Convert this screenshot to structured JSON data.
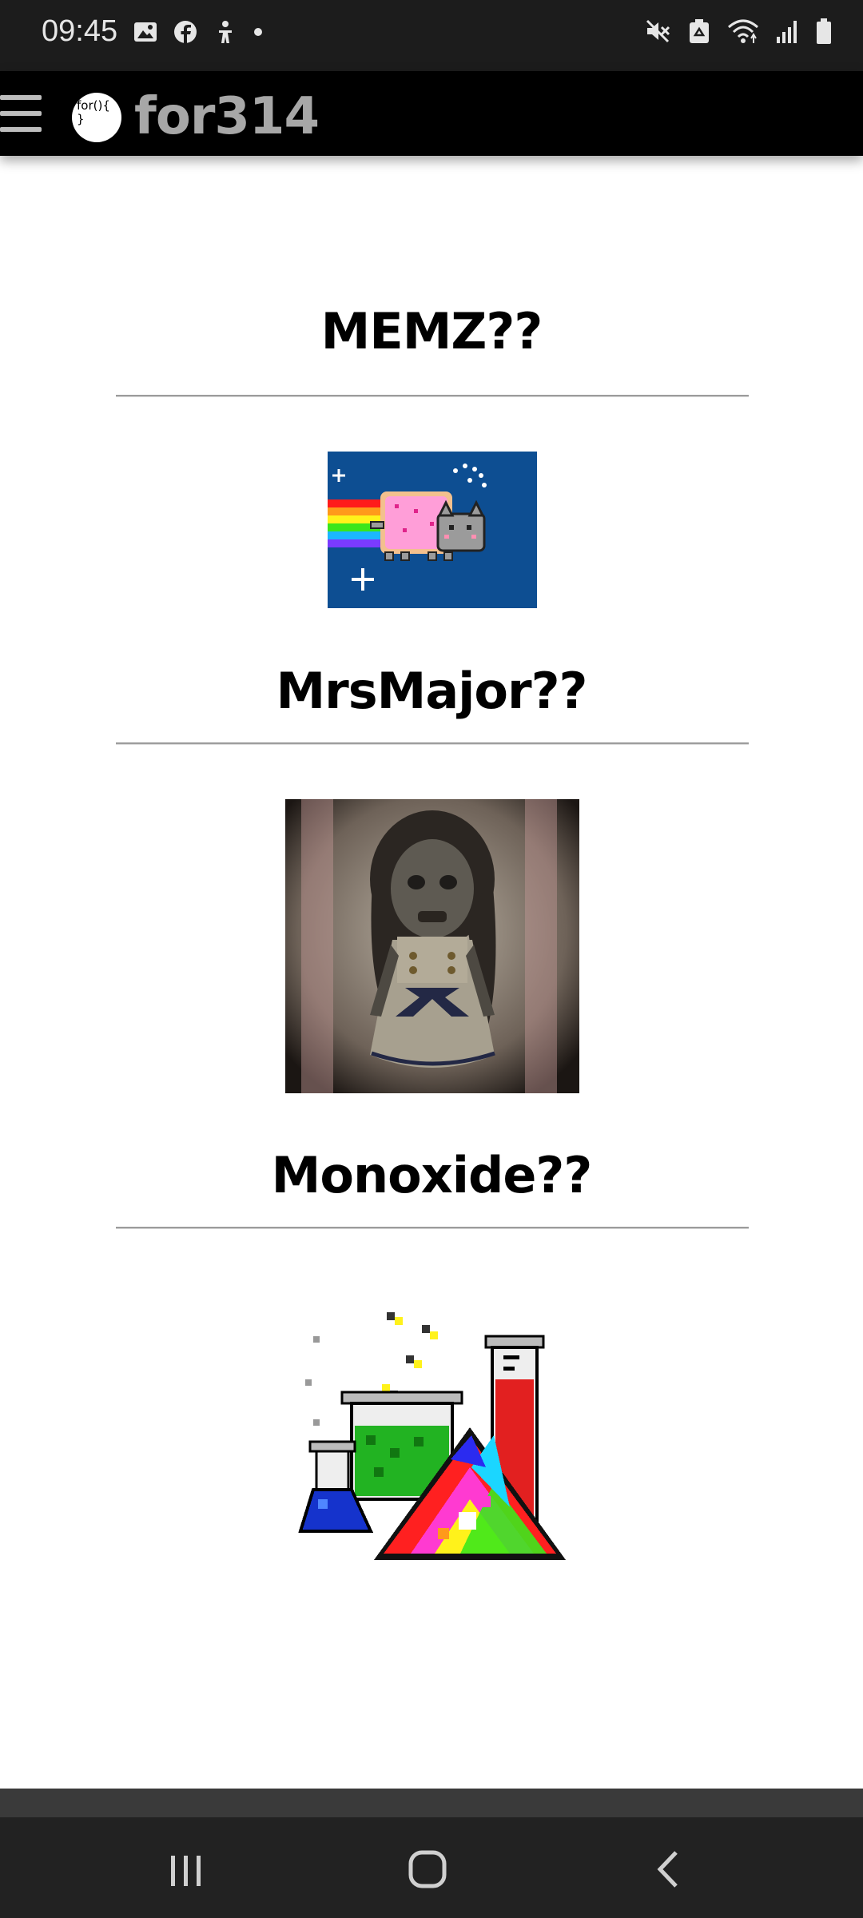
{
  "status_bar": {
    "time": "09:45",
    "left_icons": [
      "image-icon",
      "facebook-icon",
      "accessibility-icon",
      "dot-icon"
    ],
    "right_icons": [
      "mute-icon",
      "recycle-icon",
      "wifi-icon",
      "signal-icon",
      "battery-icon"
    ]
  },
  "header": {
    "logo_text": "for(){\n}",
    "brand": "for314"
  },
  "sections": [
    {
      "title": "MEMZ??",
      "image": "nyan-cat-image"
    },
    {
      "title": "MrsMajor??",
      "image": "creepy-doll-image"
    },
    {
      "title": "Monoxide??",
      "image": "chemistry-lab-image"
    }
  ],
  "colors": {
    "status_bar_bg": "#1c1c1c",
    "header_bg": "#000000",
    "brand_text": "#a7a7a7",
    "divider": "#9c9c9c",
    "nav_bar_bg": "#222222"
  },
  "nav_bar": {
    "buttons": [
      "recent-apps-icon",
      "home-icon",
      "back-icon"
    ]
  }
}
